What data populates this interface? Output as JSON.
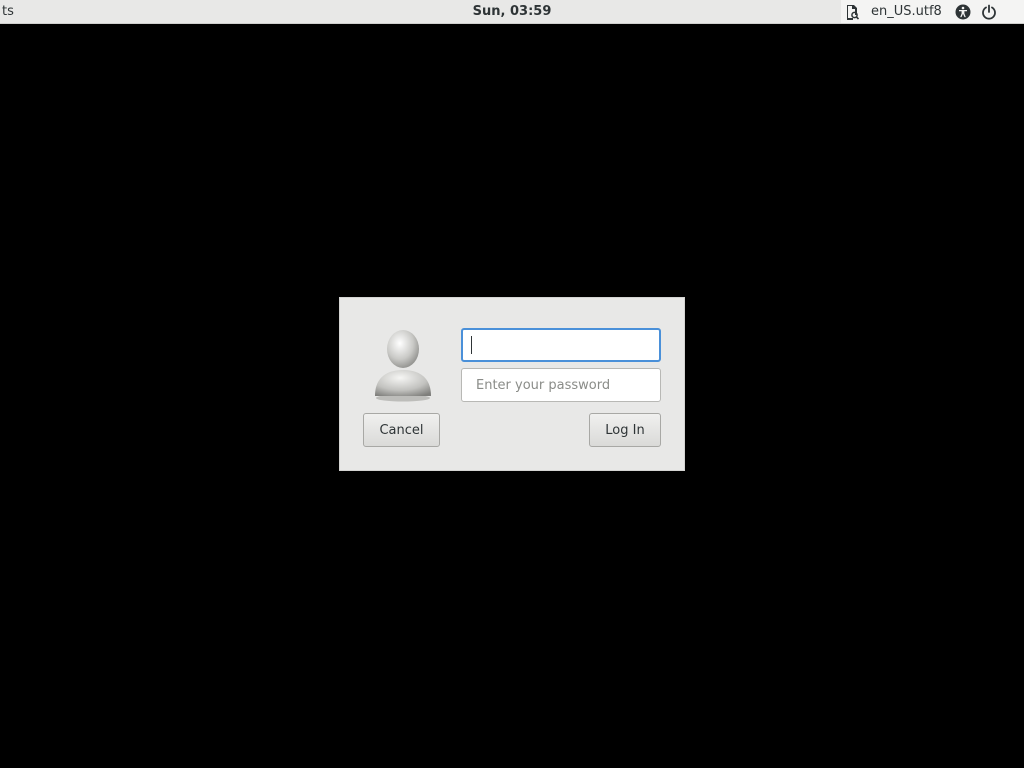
{
  "topbar": {
    "left_label": "ts",
    "clock": "Sun, 03:59",
    "tray": {
      "keyboard_icon": "keyboard-layout-icon",
      "locale": "en_US.utf8",
      "accessibility_icon": "accessibility-icon",
      "power_icon": "power-icon"
    }
  },
  "login": {
    "username_value": "",
    "password_placeholder": "Enter your password",
    "cancel_label": "Cancel",
    "login_label": "Log In",
    "avatar_icon": "user-avatar-icon"
  },
  "colors": {
    "background": "#000000",
    "panel": "#e8e8e7",
    "focus": "#4a90d9"
  }
}
